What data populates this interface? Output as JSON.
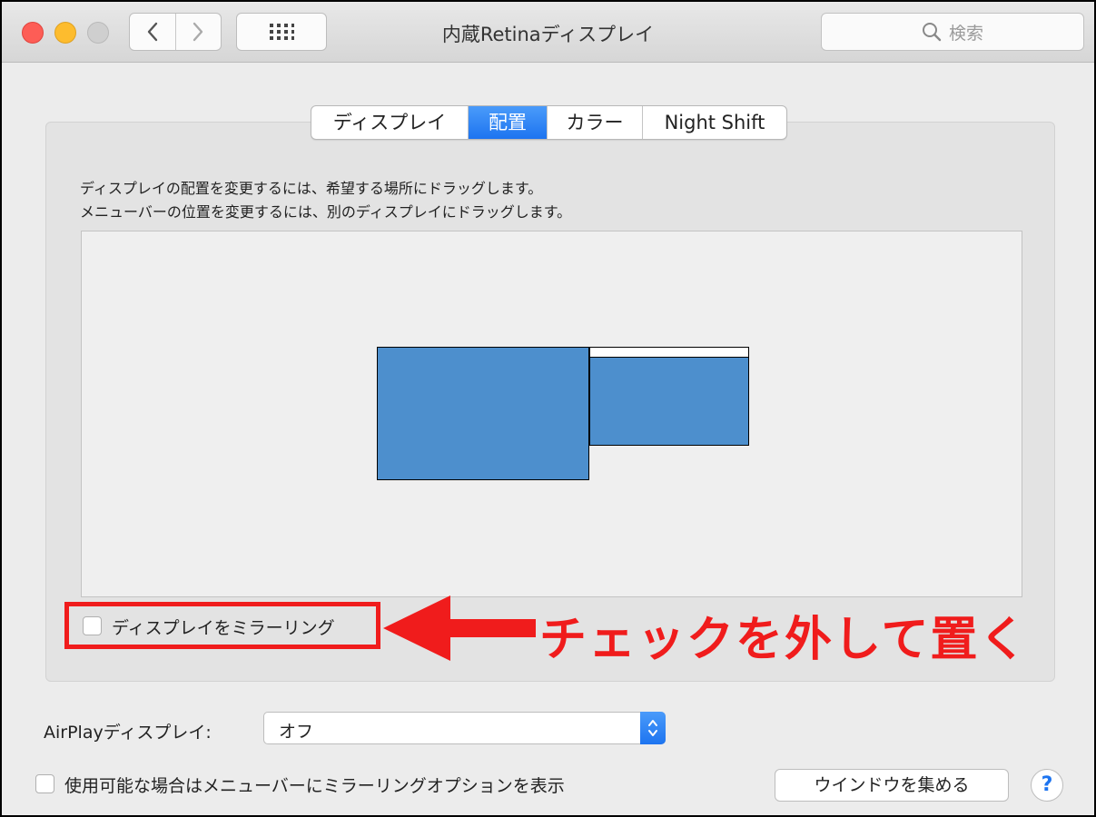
{
  "window": {
    "title": "内蔵Retinaディスプレイ",
    "search_placeholder": "検索"
  },
  "tabs": [
    {
      "label": "ディスプレイ",
      "active": false
    },
    {
      "label": "配置",
      "active": true
    },
    {
      "label": "カラー",
      "active": false
    },
    {
      "label": "Night Shift",
      "active": false
    }
  ],
  "arrangement": {
    "instruction_1": "ディスプレイの配置を変更するには、希望する場所にドラッグします。",
    "instruction_2": "メニューバーの位置を変更するには、別のディスプレイにドラッグします。"
  },
  "mirror": {
    "label": "ディスプレイをミラーリング",
    "checked": false
  },
  "annotation": {
    "text": "チェックを外して置く",
    "color": "#f01c1c"
  },
  "airplay": {
    "label": "AirPlayディスプレイ:",
    "value": "オフ"
  },
  "menu_option": {
    "label": "使用可能な場合はメニューバーにミラーリングオプションを表示",
    "checked": false
  },
  "buttons": {
    "gather_windows": "ウインドウを集める",
    "help": "?"
  },
  "colors": {
    "accent": "#1d74f0",
    "display_fill": "#4d8fcd"
  },
  "icons": {
    "back": "chevron-left-icon",
    "forward": "chevron-right-icon",
    "show_all": "grid-icon",
    "search": "magnifier-icon"
  }
}
